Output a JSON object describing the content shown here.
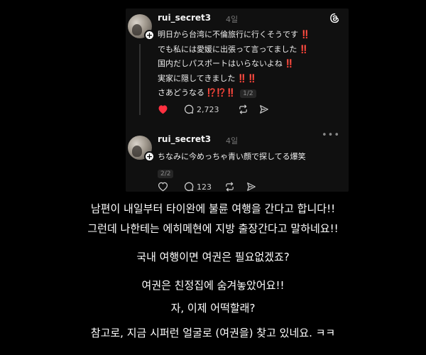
{
  "post1": {
    "username": "rui_secret3",
    "time": "4일",
    "lines": [
      "明日から台湾に不倫旅行に行くそうです",
      "でも私には愛媛に出張って言ってました",
      "国内だしパスポートはいらないよね",
      "実家に隠してきました",
      "さあどうなる"
    ],
    "marks": [
      "‼️",
      "‼️",
      "‼️",
      "‼️‼️",
      "⁉️⁉️‼️"
    ],
    "page_indicator": "1/2",
    "likes_count": "2,723",
    "liked": true
  },
  "post2": {
    "username": "rui_secret3",
    "time": "4일",
    "line": "ちなみに今めっちゃ青い顔で探してる爆笑",
    "page_indicator": "2/2",
    "reply_count": "123"
  },
  "captions": [
    "남편이 내일부터 타이완에 불륜 여행을 간다고 합니다!!",
    "그런데 나한테는 에히메현에 지방 출장간다고 말하네요!!",
    "국내 여행이면 여권은 필요없겠죠?",
    "여권은 친정집에 숨겨놓았어요!!",
    "자, 이제 어떡할래?",
    "참고로, 지금 시퍼런 얼굴로 (여권을) 찾고 있네요. ㅋㅋ"
  ],
  "colors": {
    "background": "#000000",
    "card": "#101010",
    "like_red": "#ff3040",
    "emoji_red": "#e0262d"
  },
  "icons": {
    "logo": "threads-icon",
    "like": "heart-icon",
    "reply": "comment-icon",
    "repost": "repost-icon",
    "share": "send-icon",
    "more": "more-icon"
  }
}
